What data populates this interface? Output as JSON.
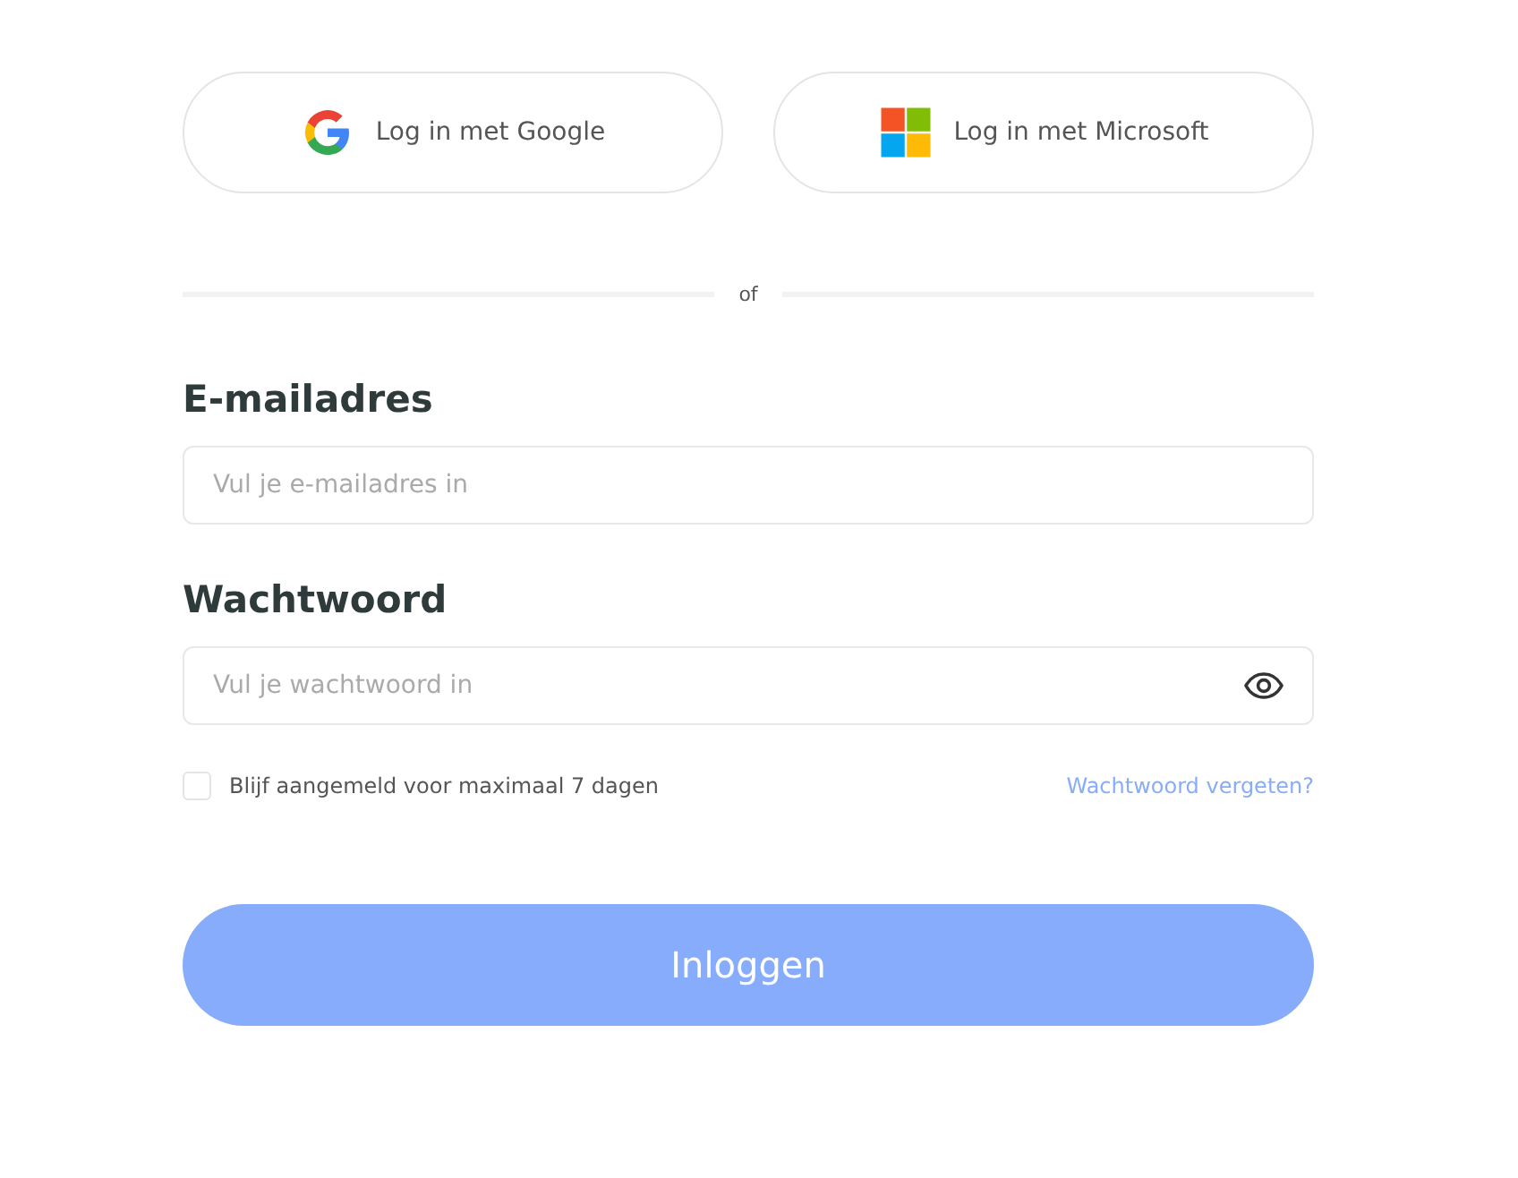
{
  "social_buttons": [
    {
      "kind": "google",
      "label": "Log in met Google"
    },
    {
      "kind": "microsoft",
      "label": "Log in met Microsoft"
    }
  ],
  "divider": "of",
  "fields": [
    {
      "kind": "text",
      "label": "E-mailadres",
      "placeholder": "Vul je e-mailadres in"
    },
    {
      "kind": "password",
      "label": "Wachtwoord",
      "placeholder": "Vul je wachtwoord in"
    }
  ],
  "remember": {
    "label": "Blijf aangemeld voor maximaal 7 dagen",
    "checked": false
  },
  "forgot_link": "Wachtwoord vergeten?",
  "submit": {
    "label": "Inloggen",
    "disabled": true
  }
}
